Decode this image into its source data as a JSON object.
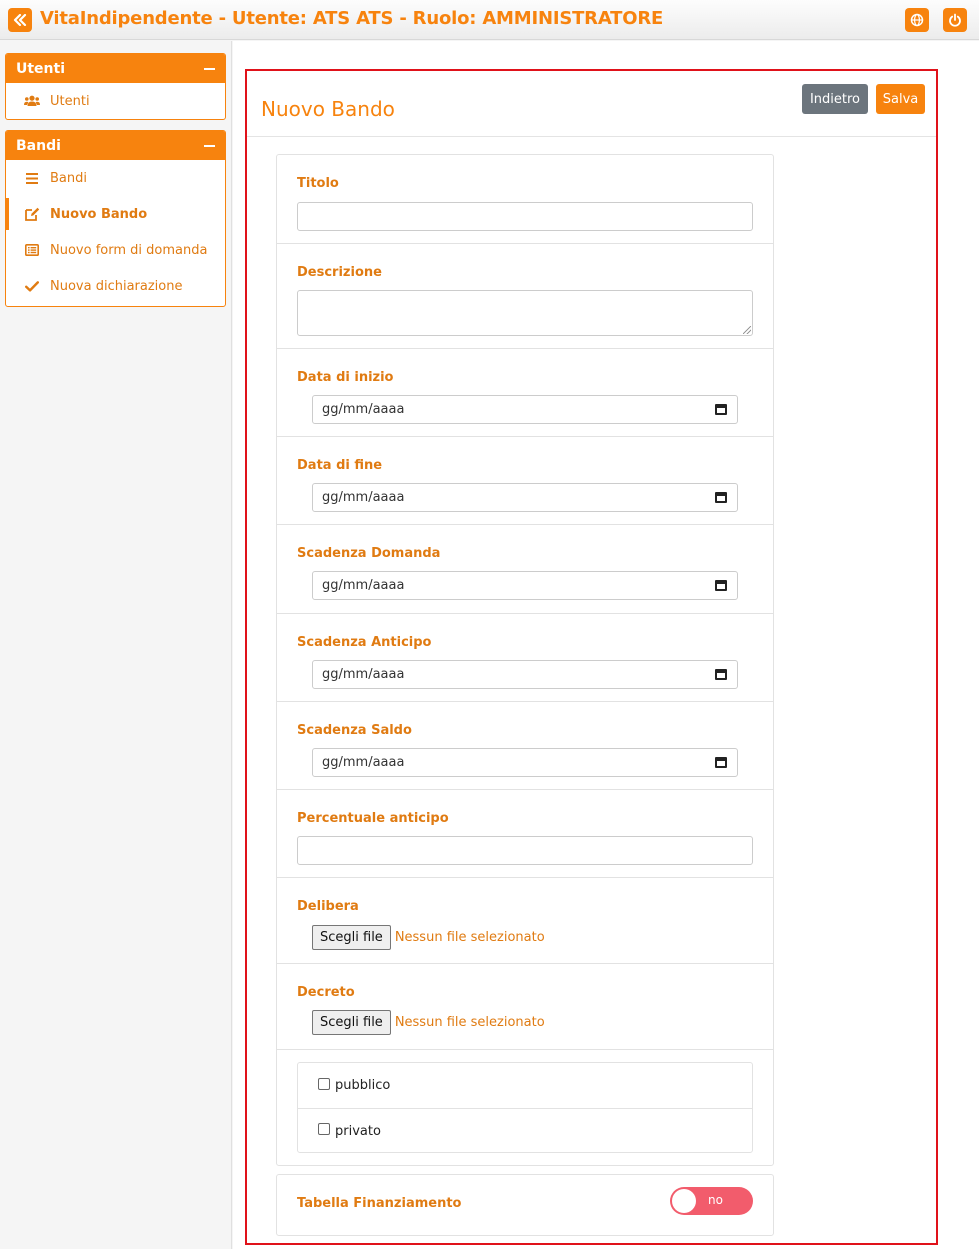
{
  "header": {
    "title": "VitaIndipendente - Utente: ATS ATS - Ruolo: AMMINISTRATORE",
    "toggle_icon": "chevron-double-left-icon",
    "globe_icon": "globe-icon",
    "power_icon": "power-icon"
  },
  "sidebar": {
    "sections": [
      {
        "title": "Utenti",
        "items": [
          {
            "label": "Utenti",
            "icon": "users-icon"
          }
        ]
      },
      {
        "title": "Bandi",
        "items": [
          {
            "label": "Bandi",
            "icon": "list-icon"
          },
          {
            "label": "Nuovo Bando",
            "icon": "edit-icon",
            "active": true
          },
          {
            "label": "Nuovo form di domanda",
            "icon": "list-alt-icon"
          },
          {
            "label": "Nuova dichiarazione",
            "icon": "check-icon"
          }
        ]
      }
    ]
  },
  "page": {
    "title": "Nuovo Bando",
    "back_label": "Indietro",
    "save_label": "Salva"
  },
  "form": {
    "titolo_label": "Titolo",
    "titolo_value": "",
    "descrizione_label": "Descrizione",
    "descrizione_value": "",
    "data_inizio_label": "Data di inizio",
    "data_fine_label": "Data di fine",
    "scadenza_domanda_label": "Scadenza Domanda",
    "scadenza_anticipo_label": "Scadenza Anticipo",
    "scadenza_saldo_label": "Scadenza Saldo",
    "date_placeholder": "gg/mm/aaaa",
    "percentuale_label": "Percentuale anticipo",
    "percentuale_value": "",
    "delibera_label": "Delibera",
    "decreto_label": "Decreto",
    "file_button": "Scegli file",
    "file_none": "Nessun file selezionato",
    "pubblico_label": "pubblico",
    "privato_label": "privato",
    "pubblico_checked": false,
    "privato_checked": false
  },
  "finanziamento": {
    "label": "Tabella Finanziamento",
    "toggle_text": "no",
    "toggle_on": false
  },
  "colors": {
    "accent": "#f7830e",
    "label": "#e07b12",
    "secondary_button": "#6c757d",
    "toggle_off": "#f25c6c",
    "frame": "#e0121a"
  }
}
